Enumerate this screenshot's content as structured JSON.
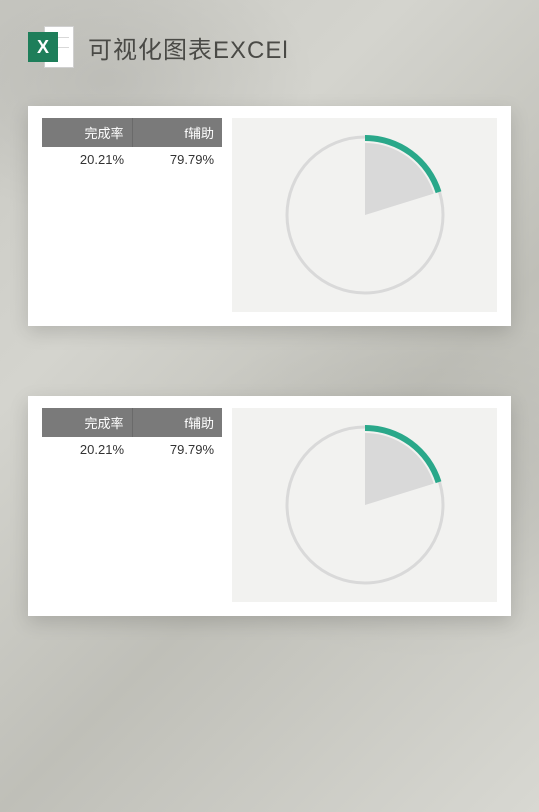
{
  "header": {
    "icon_letter": "X",
    "title": "可视化图表EXCEl"
  },
  "table": {
    "col1": "完成率",
    "col2": "f辅助",
    "val1": "20.21%",
    "val2": "79.79%"
  },
  "chart_data": [
    {
      "type": "pie",
      "title": "",
      "series": [
        {
          "name": "完成率",
          "value": 20.21,
          "color": "#2aa88a"
        },
        {
          "name": "f辅助",
          "value": 79.79,
          "color": "#d9d9d9"
        }
      ],
      "start_angle_deg": 0,
      "ring": true
    },
    {
      "type": "pie",
      "title": "",
      "series": [
        {
          "name": "完成率",
          "value": 20.21,
          "color": "#2aa88a"
        },
        {
          "name": "f辅助",
          "value": 79.79,
          "color": "#d9d9d9"
        }
      ],
      "start_angle_deg": 0,
      "ring": true
    }
  ]
}
